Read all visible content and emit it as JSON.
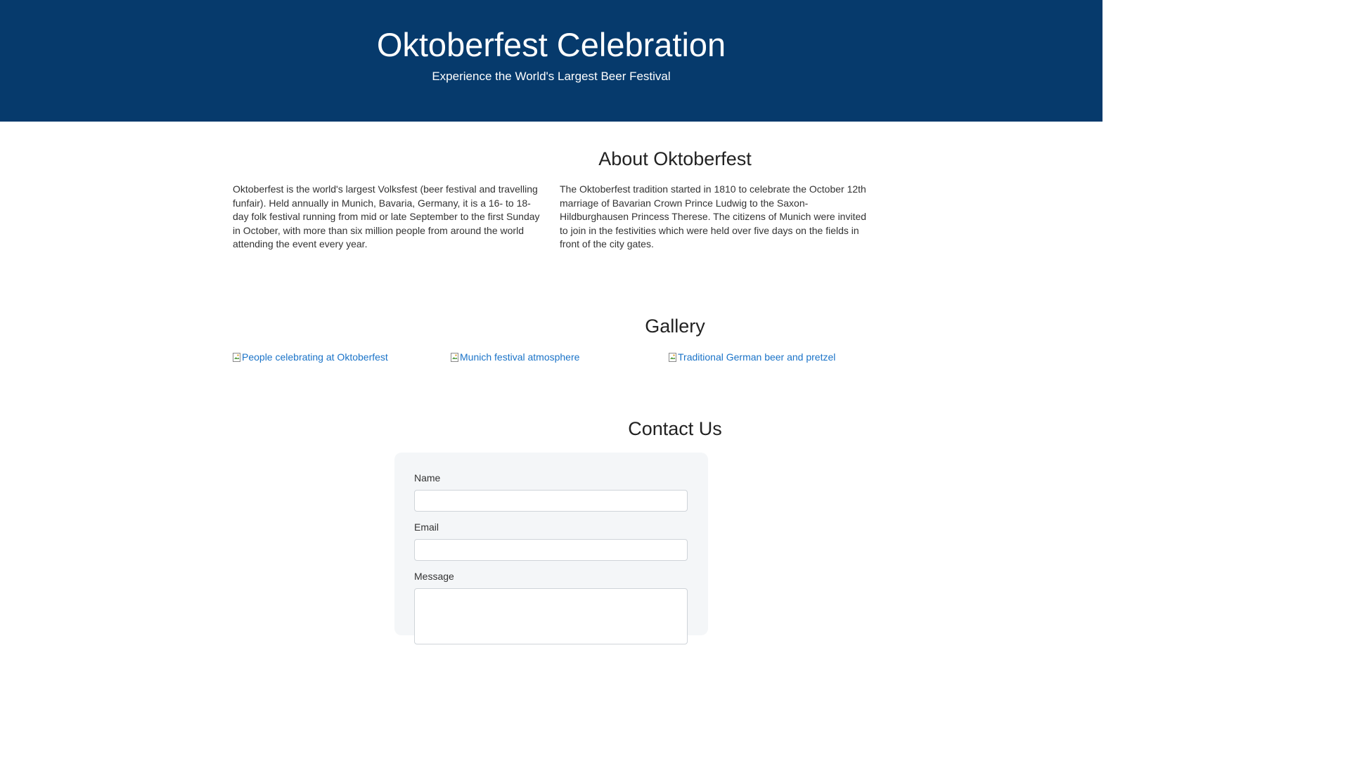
{
  "hero": {
    "title": "Oktoberfest Celebration",
    "subtitle": "Experience the World's Largest Beer Festival",
    "background_color": "#063a6c"
  },
  "about": {
    "heading": "About Oktoberfest",
    "paragraphs": [
      "Oktoberfest is the world's largest Volksfest (beer festival and travelling funfair). Held annually in Munich, Bavaria, Germany, it is a 16- to 18-day folk festival running from mid or late September to the first Sunday in October, with more than six million people from around the world attending the event every year.",
      "The Oktoberfest tradition started in 1810 to celebrate the October 12th marriage of Bavarian Crown Prince Ludwig to the Saxon-Hildburghausen Princess Therese. The citizens of Munich were invited to join in the festivities which were held over five days on the fields in front of the city gates."
    ]
  },
  "gallery": {
    "heading": "Gallery",
    "images": [
      {
        "alt": "People celebrating at Oktoberfest",
        "icon": "broken-image-icon"
      },
      {
        "alt": "Munich festival atmosphere",
        "icon": "broken-image-icon"
      },
      {
        "alt": "Traditional German beer and pretzel",
        "icon": "broken-image-icon"
      }
    ],
    "link_color": "#1a73c8"
  },
  "contact": {
    "heading": "Contact Us",
    "name_label": "Name",
    "name_value": "",
    "email_label": "Email",
    "email_value": "",
    "message_label": "Message",
    "message_value": ""
  }
}
